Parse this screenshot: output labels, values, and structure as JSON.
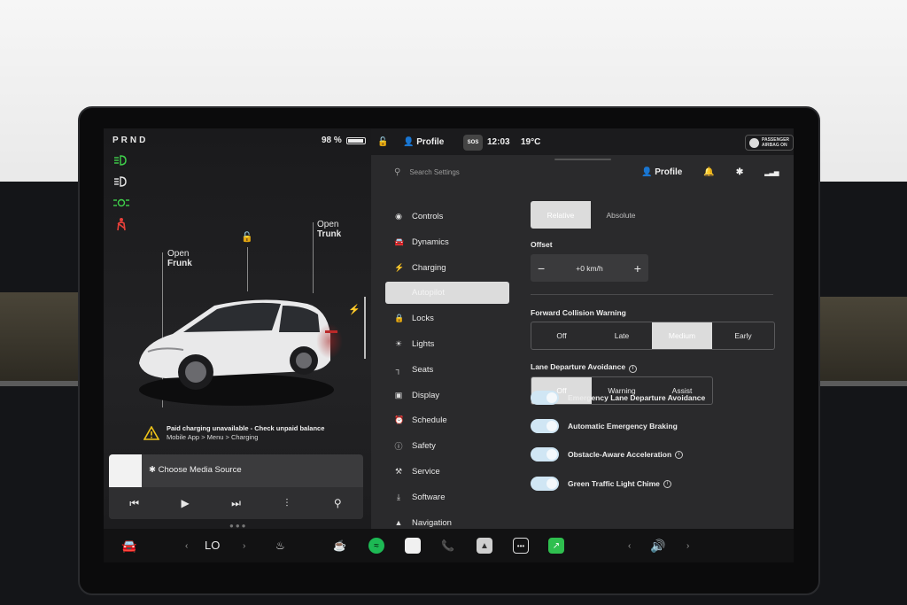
{
  "left_panel": {
    "gear": "PRND",
    "battery_percent": "98 %",
    "battery_level": 0.98,
    "frunk_label_line1": "Open",
    "frunk_label_line2": "Frunk",
    "trunk_label_line1": "Open",
    "trunk_label_line2": "Trunk",
    "warning_line1": "Paid charging unavailable - Check unpaid balance",
    "warning_line2": "Mobile App > Menu > Charging",
    "media_source": "Choose Media Source",
    "media_controls": [
      "prev-icon",
      "play-icon",
      "next-icon",
      "equalizer-icon",
      "search-icon"
    ]
  },
  "status_bar": {
    "profile_label": "Profile",
    "sos": "SOS",
    "time": "12:03",
    "temperature": "19°C",
    "airbag_line1": "PASSENGER",
    "airbag_line2": "AIRBAG ON"
  },
  "settings": {
    "search_placeholder": "Search Settings",
    "profile_label": "Profile",
    "menu": [
      {
        "label": "Controls",
        "icon": "toggle-icon"
      },
      {
        "label": "Dynamics",
        "icon": "car-icon"
      },
      {
        "label": "Charging",
        "icon": "bolt-icon"
      },
      {
        "label": "Autopilot",
        "icon": "steering-icon",
        "active": true
      },
      {
        "label": "Locks",
        "icon": "lock-icon"
      },
      {
        "label": "Lights",
        "icon": "sun-icon"
      },
      {
        "label": "Seats",
        "icon": "seat-icon"
      },
      {
        "label": "Display",
        "icon": "display-icon"
      },
      {
        "label": "Schedule",
        "icon": "clock-icon"
      },
      {
        "label": "Safety",
        "icon": "safety-icon"
      },
      {
        "label": "Service",
        "icon": "wrench-icon"
      },
      {
        "label": "Software",
        "icon": "download-icon"
      },
      {
        "label": "Navigation",
        "icon": "navigation-icon"
      }
    ],
    "speed_mode": {
      "options": [
        "Relative",
        "Absolute"
      ],
      "selected": "Relative"
    },
    "offset": {
      "label": "Offset",
      "value": "+0 km/h"
    },
    "fcw": {
      "label": "Forward Collision Warning",
      "options": [
        "Off",
        "Late",
        "Medium",
        "Early"
      ],
      "selected": "Medium"
    },
    "lda": {
      "label": "Lane Departure Avoidance",
      "options": [
        "Off",
        "Warning",
        "Assist"
      ],
      "selected": "Off"
    },
    "toggles": [
      {
        "label": "Emergency Lane Departure Avoidance",
        "on": true,
        "info": false
      },
      {
        "label": "Automatic Emergency Braking",
        "on": true,
        "info": false
      },
      {
        "label": "Obstacle-Aware Acceleration",
        "on": true,
        "info": true
      },
      {
        "label": "Green Traffic Light Chime",
        "on": true,
        "info": true
      }
    ]
  },
  "dock": {
    "climate_label": "LO",
    "items": [
      "car-icon",
      "seat-heater-icon",
      "cup-icon",
      "spotify-icon",
      "app-white-icon",
      "phone-icon",
      "camera-icon",
      "more-icon",
      "green-app-icon",
      "volume-icon"
    ]
  },
  "colors": {
    "toggle_on": "#d0e6f4",
    "selected_segment": "#e6e6e6",
    "spotify": "#1db954",
    "green_app": "#2fbf4f"
  }
}
